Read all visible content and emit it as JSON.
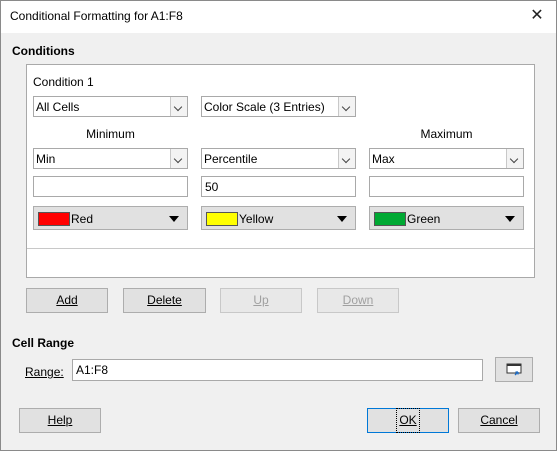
{
  "window": {
    "title": "Conditional Formatting for A1:F8"
  },
  "sections": {
    "conditions": "Conditions",
    "cell_range": "Cell Range"
  },
  "condition": {
    "heading": "Condition 1",
    "applies_to": "All Cells",
    "type": "Color Scale (3 Entries)",
    "minimum_label": "Minimum",
    "maximum_label": "Maximum",
    "entries": [
      {
        "mode": "Min",
        "value": "",
        "color_name": "Red",
        "color": "#ff0000"
      },
      {
        "mode": "Percentile",
        "value": "50",
        "color_name": "Yellow",
        "color": "#ffff00"
      },
      {
        "mode": "Max",
        "value": "",
        "color_name": "Green",
        "color": "#00a933"
      }
    ]
  },
  "buttons": {
    "add": "Add",
    "delete": "Delete",
    "up": "Up",
    "down": "Down",
    "help": "Help",
    "ok": "OK",
    "cancel": "Cancel"
  },
  "range": {
    "label": "Range:",
    "value": "A1:F8"
  },
  "icons": {
    "close": "close-icon",
    "shrink": "shrink-icon",
    "dropdown": "chevron-down-icon"
  }
}
